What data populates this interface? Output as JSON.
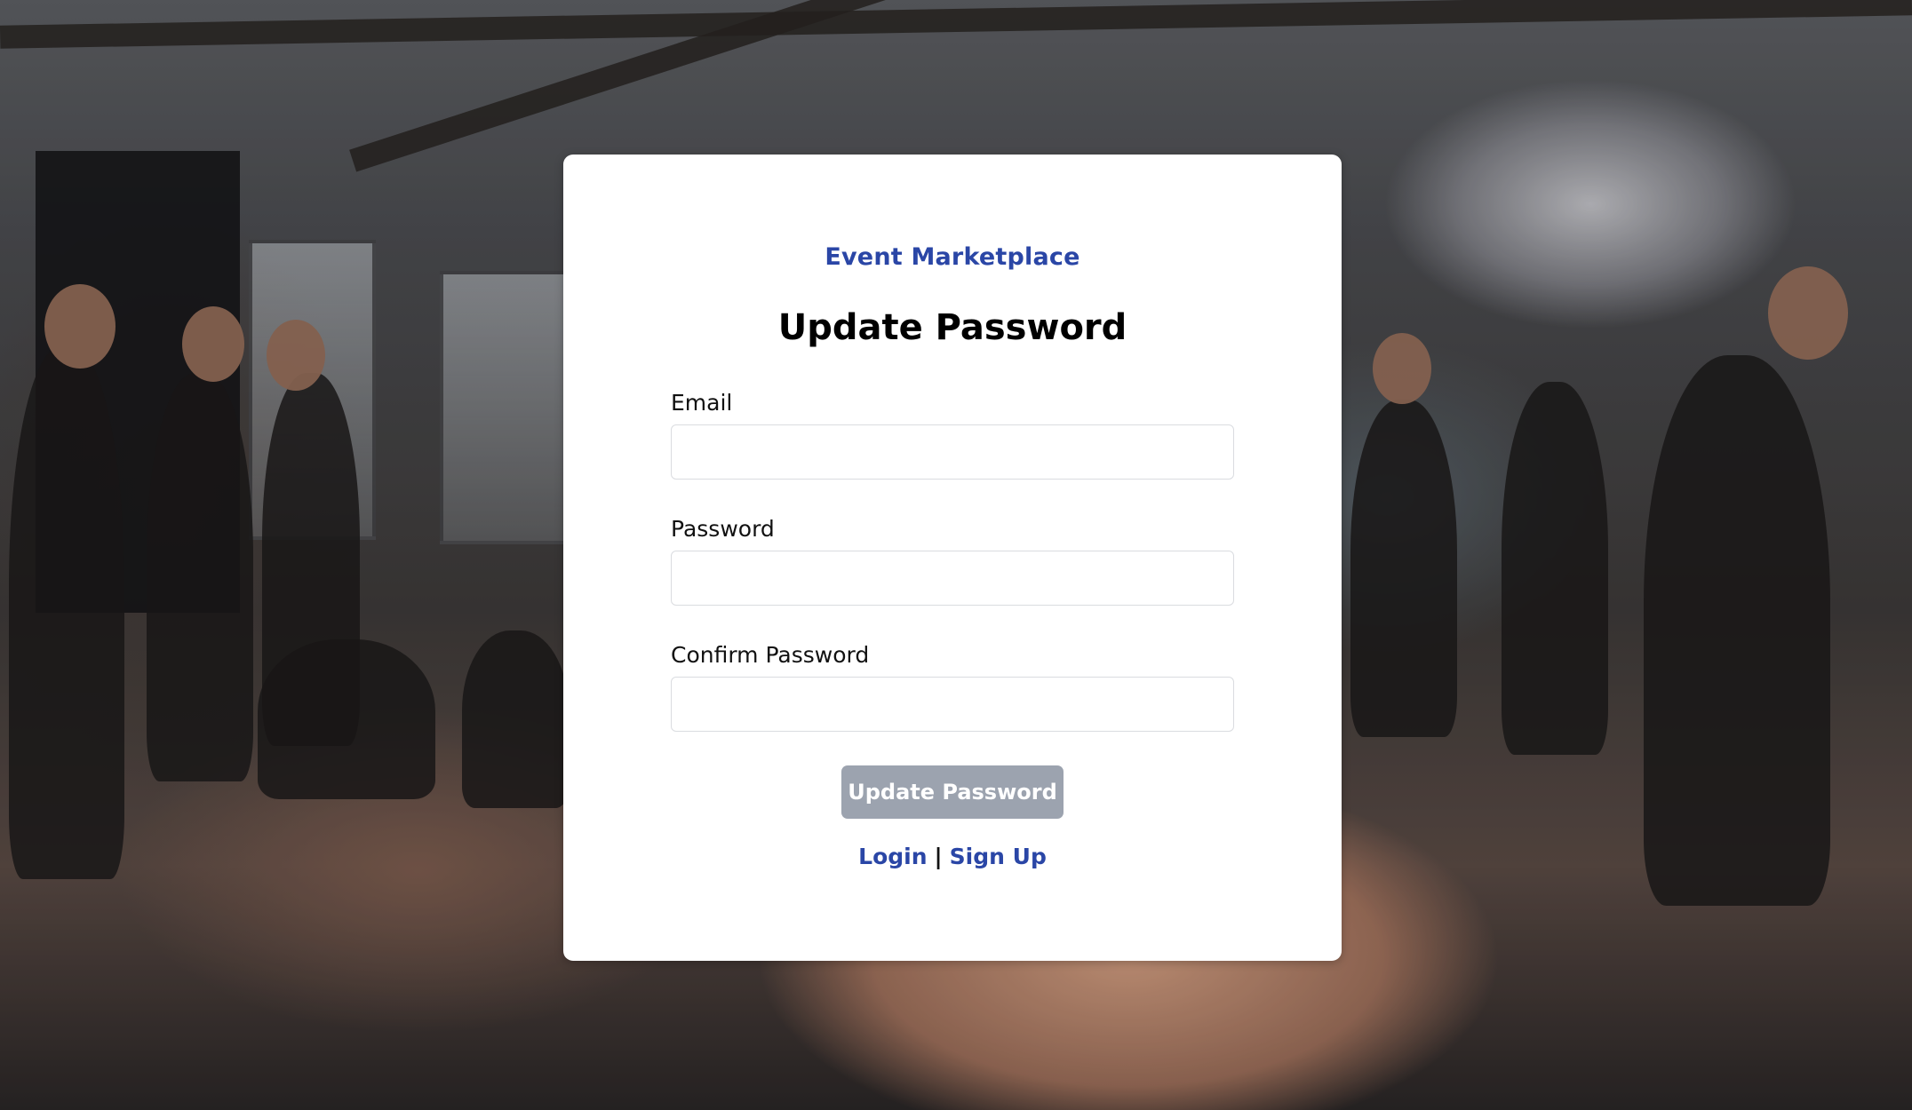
{
  "brand": {
    "name": "Event Marketplace"
  },
  "form": {
    "title": "Update Password",
    "email_label": "Email",
    "email_value": "",
    "password_label": "Password",
    "password_value": "",
    "confirm_label": "Confirm Password",
    "confirm_value": "",
    "submit_label": "Update Password"
  },
  "links": {
    "login": "Login",
    "separator": "|",
    "signup": "Sign Up"
  },
  "colors": {
    "brand": "#2a46a6",
    "button_disabled": "#9ca3af",
    "card_background": "#ffffff"
  }
}
